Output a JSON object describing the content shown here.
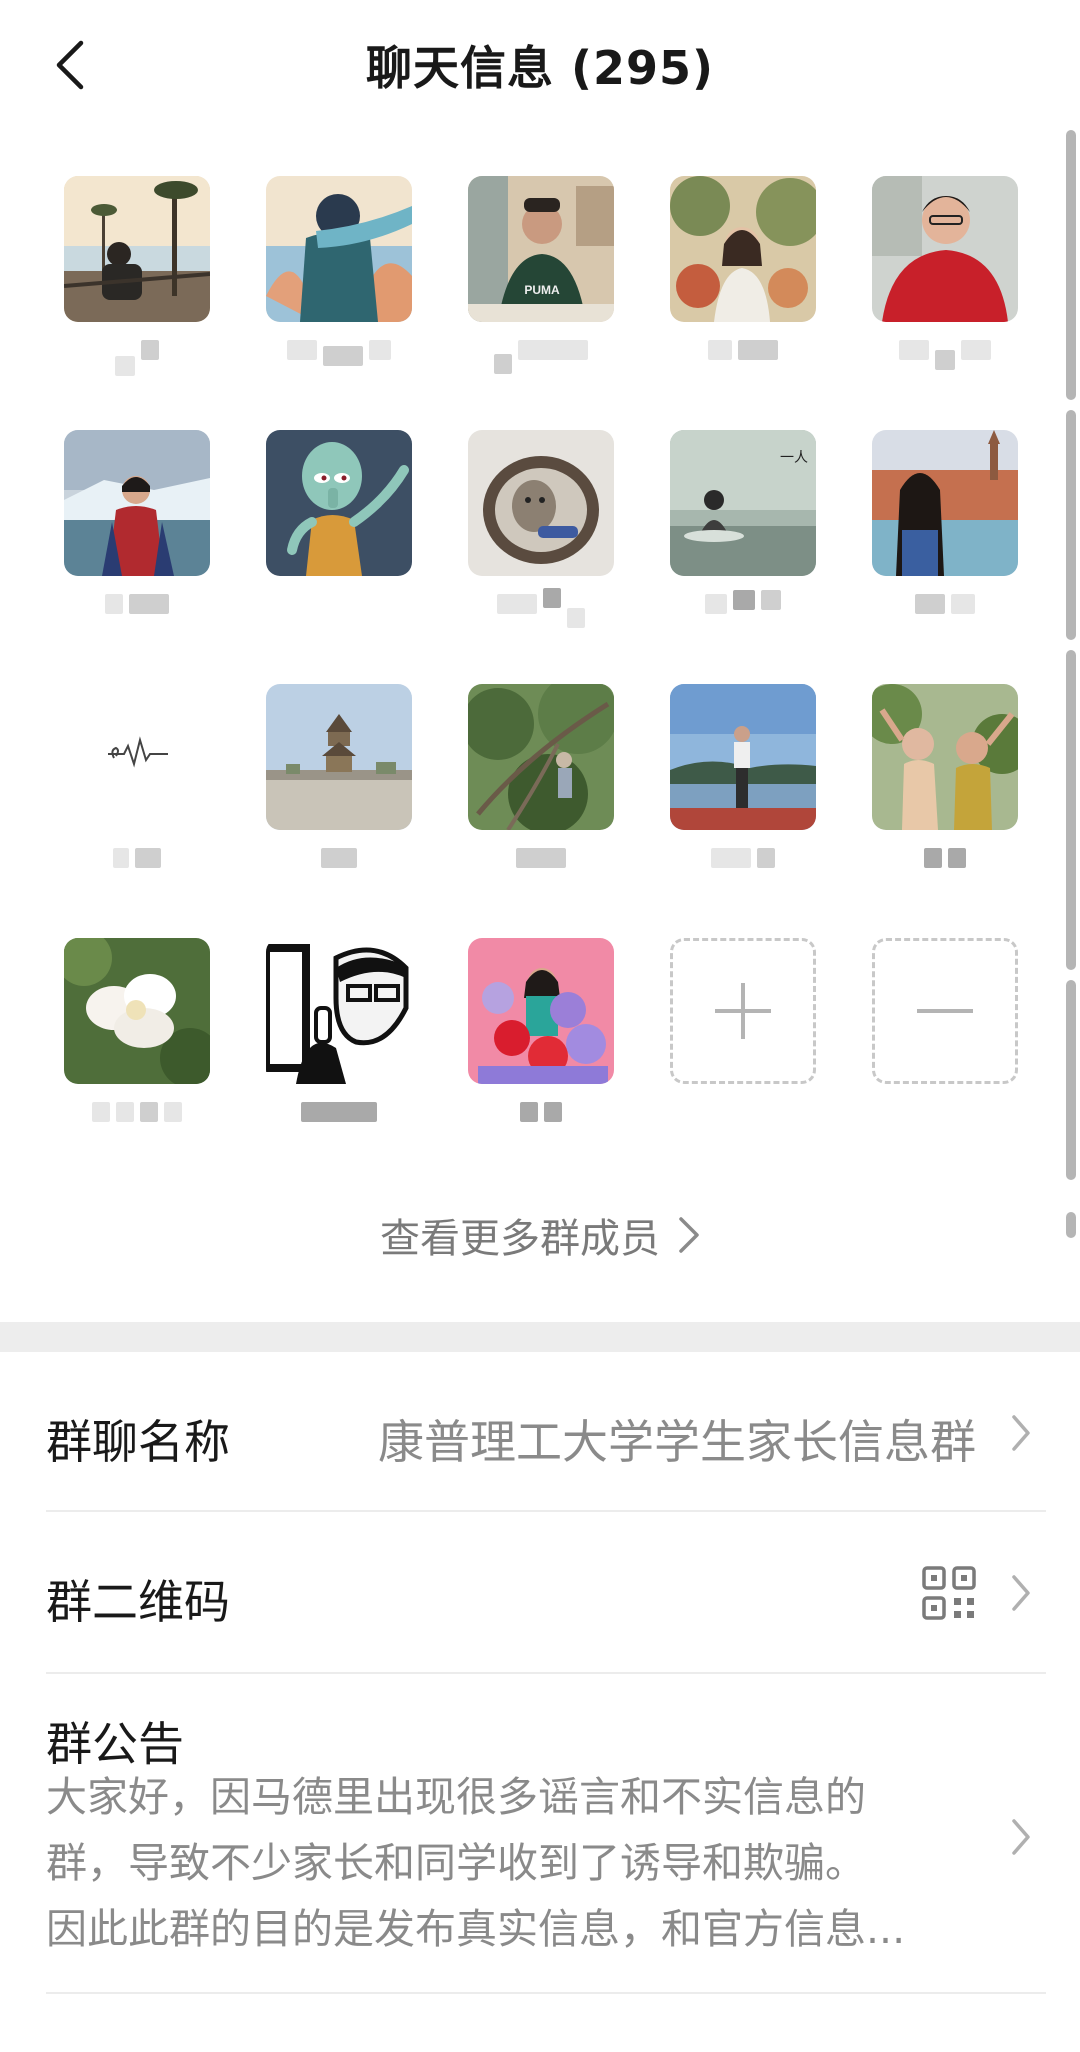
{
  "header": {
    "title": "聊天信息 (295)",
    "back_icon": "chevron-left-icon"
  },
  "members": [
    {
      "name_hint": "blurred",
      "avatar": "beach-balcony-photo"
    },
    {
      "name_hint": "blurred",
      "avatar": "illustrated-boy-scarf"
    },
    {
      "name_hint": "blurred",
      "avatar": "man-green-puma-shirt"
    },
    {
      "name_hint": "blurred",
      "avatar": "girl-with-flowers"
    },
    {
      "name_hint": "blurred",
      "avatar": "man-red-sweater"
    },
    {
      "name_hint": "blurred",
      "avatar": "woman-glacier"
    },
    {
      "name_hint": "",
      "avatar": "cartoon-squid-dab"
    },
    {
      "name_hint": "blurred",
      "avatar": "cat-in-cup"
    },
    {
      "name_hint": "blurred",
      "avatar": "woman-lake-misty"
    },
    {
      "name_hint": "blurred",
      "avatar": "woman-plaza"
    },
    {
      "name_hint": "blurred",
      "avatar": "heartbeat-line"
    },
    {
      "name_hint": "blurred",
      "avatar": "pagoda-landscape"
    },
    {
      "name_hint": "blurred",
      "avatar": "tree-branches"
    },
    {
      "name_hint": "blurred",
      "avatar": "man-on-boat"
    },
    {
      "name_hint": "blurred",
      "avatar": "two-women-plants"
    },
    {
      "name_hint": "blurred",
      "avatar": "white-flower"
    },
    {
      "name_hint": "blurred",
      "avatar": "sketch-thumbs-up"
    },
    {
      "name_hint": "blurred",
      "avatar": "woman-balloons"
    }
  ],
  "actions": {
    "add_icon": "plus-icon",
    "remove_icon": "minus-icon"
  },
  "more_members": {
    "label": "查看更多群成员",
    "icon": "chevron-right-icon"
  },
  "settings": {
    "group_name": {
      "label": "群聊名称",
      "value": "康普理工大学学生家长信息群"
    },
    "qr_code": {
      "label": "群二维码",
      "icon": "qr-code-icon"
    },
    "notice": {
      "label": "群公告",
      "lines": [
        "大家好，因马德里出现很多谣言和不实信息的",
        "群，导致不少家长和同学收到了诱导和欺骗。",
        "因此此群的目的是发布真实信息，和官方信息..."
      ]
    }
  },
  "colors": {
    "background": "#ffffff",
    "separator_band": "#ededed",
    "secondary_text": "#8a8a8a",
    "primary_text": "#191919"
  }
}
